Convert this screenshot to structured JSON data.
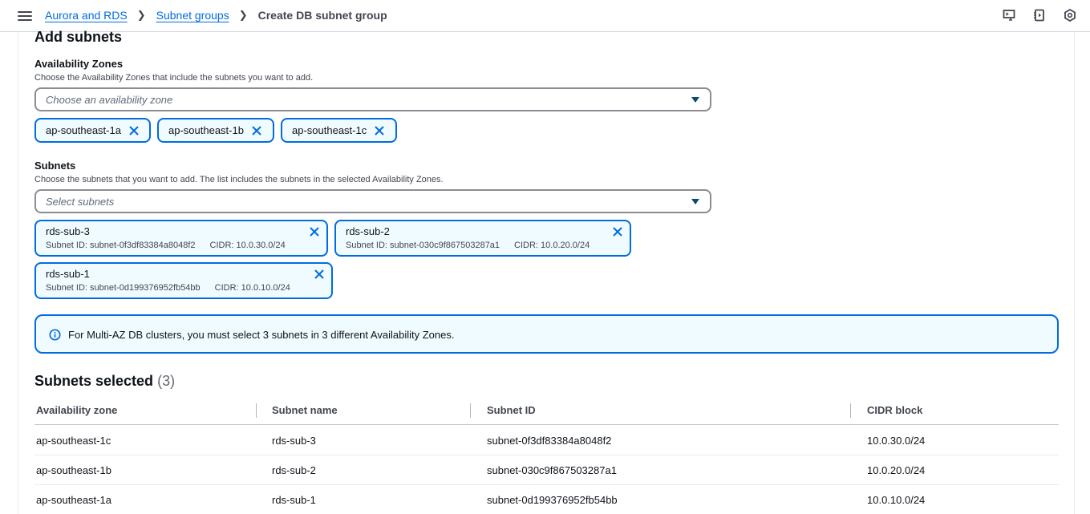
{
  "breadcrumbs": {
    "item1": "Aurora and RDS",
    "item2": "Subnet groups",
    "current": "Create DB subnet group"
  },
  "top_icons": [
    "cloudshell-icon",
    "notifications-icon",
    "settings-icon"
  ],
  "add_subnets": {
    "heading": "Add subnets",
    "az": {
      "label": "Availability Zones",
      "description": "Choose the Availability Zones that include the subnets you want to add.",
      "placeholder": "Choose an availability zone",
      "tokens": [
        "ap-southeast-1a",
        "ap-southeast-1b",
        "ap-southeast-1c"
      ]
    },
    "subnets": {
      "label": "Subnets",
      "description": "Choose the subnets that you want to add. The list includes the subnets in the selected Availability Zones.",
      "placeholder": "Select subnets",
      "tokens": [
        {
          "name": "rds-sub-3",
          "id_text": "Subnet ID: subnet-0f3df83384a8048f2",
          "cidr_text": "CIDR: 10.0.30.0/24"
        },
        {
          "name": "rds-sub-2",
          "id_text": "Subnet ID: subnet-030c9f867503287a1",
          "cidr_text": "CIDR: 10.0.20.0/24"
        },
        {
          "name": "rds-sub-1",
          "id_text": "Subnet ID: subnet-0d199376952fb54bb",
          "cidr_text": "CIDR: 10.0.10.0/24"
        }
      ]
    },
    "alert": "For Multi-AZ DB clusters, you must select 3 subnets in 3 different Availability Zones."
  },
  "selected": {
    "heading": "Subnets selected",
    "count": "(3)",
    "columns": [
      "Availability zone",
      "Subnet name",
      "Subnet ID",
      "CIDR block"
    ],
    "rows": [
      [
        "ap-southeast-1c",
        "rds-sub-3",
        "subnet-0f3df83384a8048f2",
        "10.0.30.0/24"
      ],
      [
        "ap-southeast-1b",
        "rds-sub-2",
        "subnet-030c9f867503287a1",
        "10.0.20.0/24"
      ],
      [
        "ap-southeast-1a",
        "rds-sub-1",
        "subnet-0d199376952fb54bb",
        "10.0.10.0/24"
      ]
    ]
  },
  "colors": {
    "accent": "#006ce0",
    "info_bg": "#f0fbff",
    "text": "#0f141a"
  }
}
